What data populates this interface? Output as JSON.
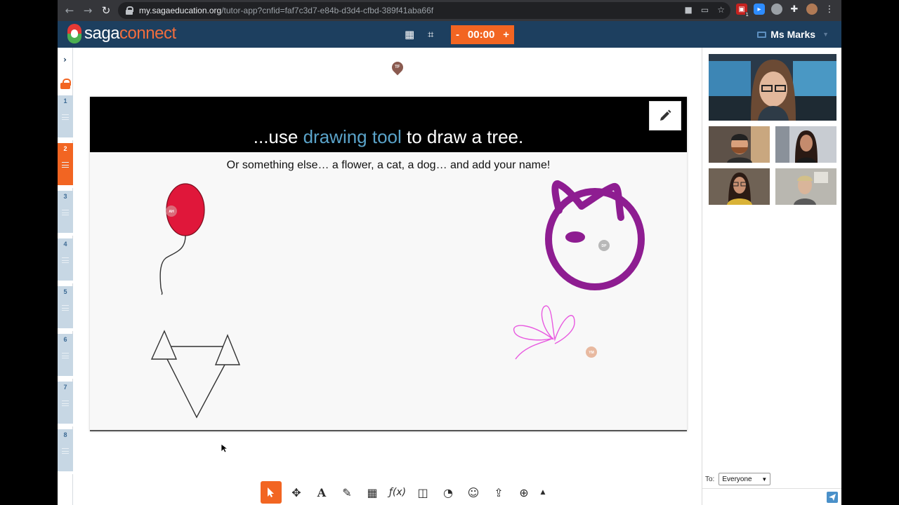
{
  "browser": {
    "url_host": "my.sagaeducation.org",
    "url_path": "/tutor-app?cnfid=faf7c3d7-e84b-d3d4-cfbd-389f41aba66f",
    "ext_badge": "1"
  },
  "header": {
    "logo_saga": "saga",
    "logo_connect": "connect",
    "timer_minus": "-",
    "timer_value": "00:00",
    "timer_plus": "+",
    "user_name": "Ms Marks"
  },
  "rail": {
    "slides": [
      "1",
      "2",
      "3",
      "4",
      "5",
      "6",
      "7",
      "8"
    ],
    "active_slide": "2"
  },
  "slide": {
    "title_pre": "...use ",
    "title_highlight": "drawing tool",
    "title_post": " to draw a tree.",
    "subtitle": "Or something else… a flower, a cat, a dog… and add your name!"
  },
  "cursors": {
    "tf": "TF",
    "ah": "AH",
    "dp": "DP",
    "ym": "YM"
  },
  "chat": {
    "to_label": "To:",
    "to_value": "Everyone"
  },
  "colors": {
    "header_bg": "#1d3f5f",
    "accent": "#f26522",
    "title_highlight": "#5aa3c9",
    "balloon": "#e0173a",
    "cat": "#8e1d91",
    "flower": "#e85ae0"
  }
}
